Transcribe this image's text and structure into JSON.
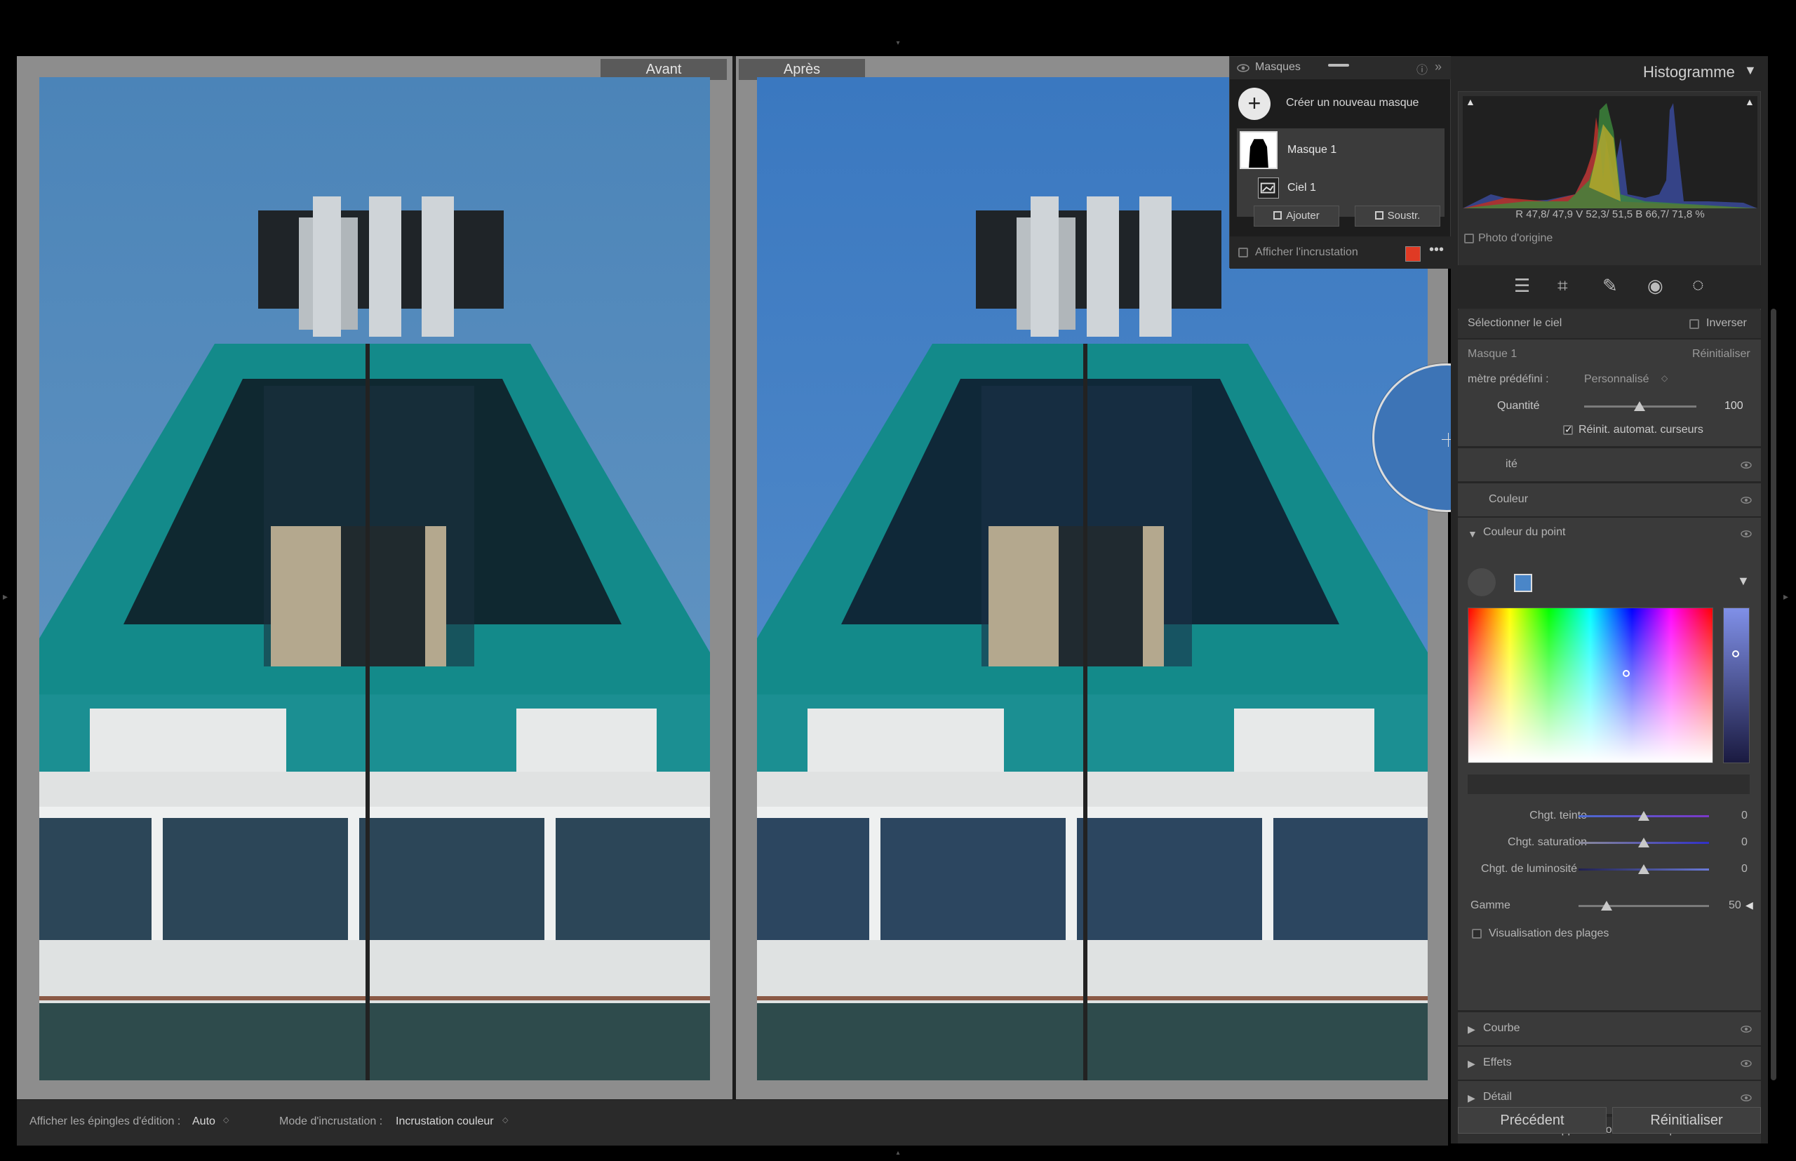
{
  "view": {
    "before_label": "Avant",
    "after_label": "Après"
  },
  "bottombar": {
    "pins_label": "Afficher les épingles d'édition :",
    "pins_value": "Auto",
    "overlay_label": "Mode d'incrustation :",
    "overlay_value": "Incrustation couleur"
  },
  "histogram": {
    "title": "Histogramme",
    "rgb_readout": {
      "r_label": "R",
      "r_value": "47,8/ 47,9",
      "v_label": "V",
      "v_value": "52,3/ 51,5",
      "b_label": "B",
      "b_value": "66,7/ 71,8 %"
    },
    "original_photo_label": "Photo d'origine"
  },
  "masks_panel": {
    "title": "Masques",
    "create_label": "Créer un nouveau masque",
    "mask_name": "Masque 1",
    "component_name": "Ciel 1",
    "add_label": "Ajouter",
    "subtract_label": "Soustr.",
    "overlay_label": "Afficher l'incrustation",
    "overlay_color": "#e03a24"
  },
  "tools": [
    "sliders-icon",
    "crop-icon",
    "heal-icon",
    "redeye-icon",
    "mask-icon"
  ],
  "mask_panel": {
    "select_sky": "Sélectionner le ciel",
    "invert": "Inverser",
    "mask_name": "Masque 1",
    "reset": "Réinitialiser",
    "preset_label": "mètre prédéfini :",
    "preset_value": "Personnalisé",
    "amount_label": "Quantité",
    "amount_value": "100",
    "auto_reset": "Réinit. automat. curseurs",
    "sections_collapsed_1": "ité",
    "sections_collapsed_2": "Couleur",
    "point_color": "Couleur du point",
    "sliders": [
      {
        "label": "Chgt. teinte",
        "value": "0"
      },
      {
        "label": "Chgt. saturation",
        "value": "0"
      },
      {
        "label": "Chgt. de luminosité",
        "value": "0"
      }
    ],
    "gamme_label": "Gamme",
    "gamme_value": "50",
    "range_vis": "Visualisation des plages",
    "sections": [
      "Courbe",
      "Effets",
      "Détail"
    ],
    "delete_all": "Supprimer tous les masques",
    "close": "Fermer",
    "swatch_color": "#4a86c8"
  },
  "footer": {
    "prev": "Précédent",
    "reset": "Réinitialiser"
  }
}
